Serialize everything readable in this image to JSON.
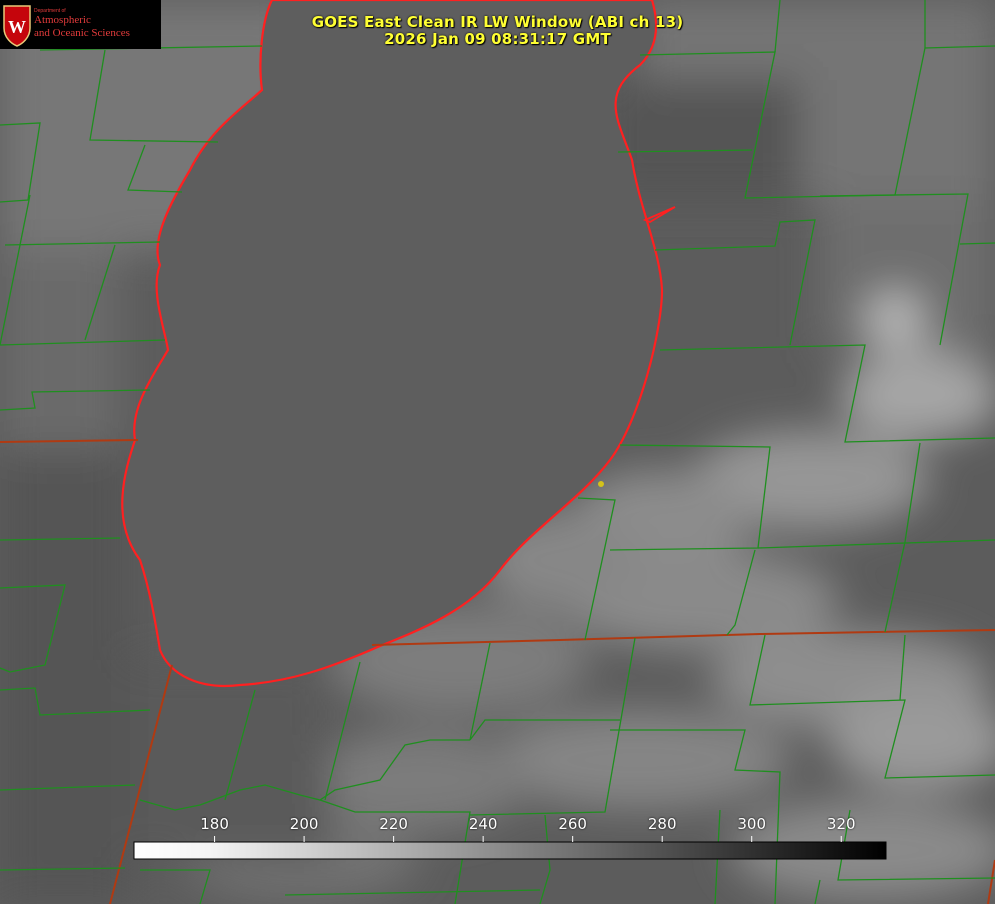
{
  "title": {
    "line1": "GOES East Clean IR LW Window (ABI ch 13)",
    "line2": "2026 Jan 09 08:31:17 GMT"
  },
  "logo": {
    "department": "Department of",
    "line1": "Atmospheric",
    "line2": "and Oceanic Sciences",
    "icon": "uw-crest-icon",
    "shield_color": "#c5050c"
  },
  "colorbar": {
    "ticks": [
      "180",
      "200",
      "220",
      "240",
      "260",
      "280",
      "300",
      "320"
    ],
    "tick_values": [
      180,
      200,
      220,
      240,
      260,
      280,
      300,
      320
    ],
    "min": 162,
    "max": 330,
    "low_color": "#ffffff",
    "high_color": "#000000"
  },
  "colors": {
    "title": "#ffff33",
    "county_lines": "#1f8f1f",
    "state_lines": "#b03a12",
    "shoreline": "#ff2020",
    "marker": "#d4c21a"
  }
}
